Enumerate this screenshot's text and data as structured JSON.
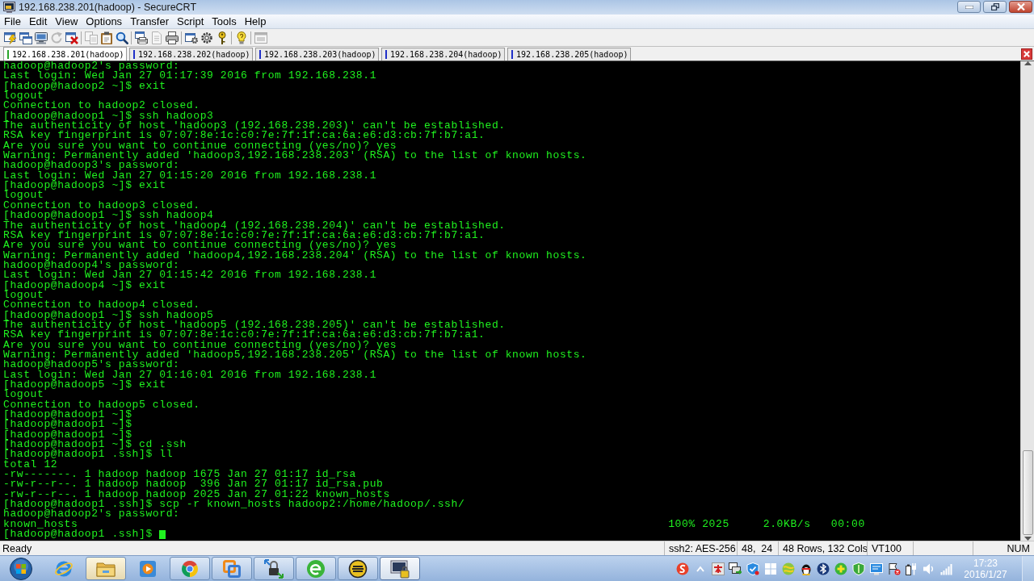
{
  "window": {
    "title": "192.168.238.201(hadoop) - SecureCRT"
  },
  "menu": [
    "File",
    "Edit",
    "View",
    "Options",
    "Transfer",
    "Script",
    "Tools",
    "Help"
  ],
  "toolbar": {
    "groups": [
      [
        {
          "disabled": false
        },
        {
          "disabled": false
        },
        {
          "disabled": false
        },
        {
          "disabled": true
        },
        {
          "disabled": false
        }
      ],
      [
        {
          "disabled": true
        },
        {
          "disabled": false
        },
        {
          "disabled": false
        }
      ],
      [
        {
          "disabled": false
        },
        {
          "disabled": true
        },
        {
          "disabled": false
        }
      ],
      [
        {
          "disabled": false
        },
        {
          "disabled": false
        },
        {
          "disabled": false
        }
      ],
      [
        {
          "disabled": false
        }
      ],
      [
        {
          "disabled": true
        }
      ]
    ]
  },
  "tabs": [
    {
      "label": "192.168.238.201(hadoop)",
      "selected": true,
      "color": "#2aa52a"
    },
    {
      "label": "192.168.238.202(hadoop)",
      "selected": false,
      "color": "#1f2fc8"
    },
    {
      "label": "192.168.238.203(hadoop)",
      "selected": false,
      "color": "#1f2fc8"
    },
    {
      "label": "192.168.238.204(hadoop)",
      "selected": false,
      "color": "#1f2fc8"
    },
    {
      "label": "192.168.238.205(hadoop)",
      "selected": false,
      "color": "#1f2fc8"
    }
  ],
  "terminal": {
    "lines": [
      {
        "kind": "out",
        "text": "hadoop@hadoop2's password:"
      },
      {
        "kind": "out",
        "text": "Last login: Wed Jan 27 01:17:39 2016 from 192.168.238.1"
      },
      {
        "kind": "out",
        "text": "[hadoop@hadoop2 ~]$ exit"
      },
      {
        "kind": "out",
        "text": "logout"
      },
      {
        "kind": "out",
        "text": "Connection to hadoop2 closed."
      },
      {
        "kind": "out",
        "text": "[hadoop@hadoop1 ~]$ ssh hadoop3"
      },
      {
        "kind": "out",
        "text": "The authenticity of host 'hadoop3 (192.168.238.203)' can't be established."
      },
      {
        "kind": "out",
        "text": "RSA key fingerprint is 07:07:8e:1c:c0:7e:7f:1f:ca:6a:e6:d3:cb:7f:b7:a1."
      },
      {
        "kind": "out",
        "text": "Are you sure you want to continue connecting (yes/no)? yes"
      },
      {
        "kind": "out",
        "text": "Warning: Permanently added 'hadoop3,192.168.238.203' (RSA) to the list of known hosts."
      },
      {
        "kind": "out",
        "text": "hadoop@hadoop3's password:"
      },
      {
        "kind": "out",
        "text": "Last login: Wed Jan 27 01:15:20 2016 from 192.168.238.1"
      },
      {
        "kind": "out",
        "text": "[hadoop@hadoop3 ~]$ exit"
      },
      {
        "kind": "out",
        "text": "logout"
      },
      {
        "kind": "out",
        "text": "Connection to hadoop3 closed."
      },
      {
        "kind": "out",
        "text": "[hadoop@hadoop1 ~]$ ssh hadoop4"
      },
      {
        "kind": "out",
        "text": "The authenticity of host 'hadoop4 (192.168.238.204)' can't be established."
      },
      {
        "kind": "out",
        "text": "RSA key fingerprint is 07:07:8e:1c:c0:7e:7f:1f:ca:6a:e6:d3:cb:7f:b7:a1."
      },
      {
        "kind": "out",
        "text": "Are you sure you want to continue connecting (yes/no)? yes"
      },
      {
        "kind": "out",
        "text": "Warning: Permanently added 'hadoop4,192.168.238.204' (RSA) to the list of known hosts."
      },
      {
        "kind": "out",
        "text": "hadoop@hadoop4's password:"
      },
      {
        "kind": "out",
        "text": "Last login: Wed Jan 27 01:15:42 2016 from 192.168.238.1"
      },
      {
        "kind": "out",
        "text": "[hadoop@hadoop4 ~]$ exit"
      },
      {
        "kind": "out",
        "text": "logout"
      },
      {
        "kind": "out",
        "text": "Connection to hadoop4 closed."
      },
      {
        "kind": "out",
        "text": "[hadoop@hadoop1 ~]$ ssh hadoop5"
      },
      {
        "kind": "out",
        "text": "The authenticity of host 'hadoop5 (192.168.238.205)' can't be established."
      },
      {
        "kind": "out",
        "text": "RSA key fingerprint is 07:07:8e:1c:c0:7e:7f:1f:ca:6a:e6:d3:cb:7f:b7:a1."
      },
      {
        "kind": "out",
        "text": "Are you sure you want to continue connecting (yes/no)? yes"
      },
      {
        "kind": "out",
        "text": "Warning: Permanently added 'hadoop5,192.168.238.205' (RSA) to the list of known hosts."
      },
      {
        "kind": "out",
        "text": "hadoop@hadoop5's password:"
      },
      {
        "kind": "out",
        "text": "Last login: Wed Jan 27 01:16:01 2016 from 192.168.238.1"
      },
      {
        "kind": "out",
        "text": "[hadoop@hadoop5 ~]$ exit"
      },
      {
        "kind": "out",
        "text": "logout"
      },
      {
        "kind": "out",
        "text": "Connection to hadoop5 closed."
      },
      {
        "kind": "out",
        "text": "[hadoop@hadoop1 ~]$"
      },
      {
        "kind": "out",
        "text": "[hadoop@hadoop1 ~]$"
      },
      {
        "kind": "out",
        "text": "[hadoop@hadoop1 ~]$"
      },
      {
        "kind": "out",
        "text": "[hadoop@hadoop1 ~]$ cd .ssh"
      },
      {
        "kind": "out",
        "text": "[hadoop@hadoop1 .ssh]$ ll"
      },
      {
        "kind": "out",
        "text": "total 12"
      },
      {
        "kind": "out",
        "text": "-rw-------. 1 hadoop hadoop 1675 Jan 27 01:17 id_rsa"
      },
      {
        "kind": "out",
        "text": "-rw-r--r--. 1 hadoop hadoop  396 Jan 27 01:17 id_rsa.pub"
      },
      {
        "kind": "out",
        "text": "-rw-r--r--. 1 hadoop hadoop 2025 Jan 27 01:22 known_hosts"
      },
      {
        "kind": "out",
        "text": "[hadoop@hadoop1 .ssh]$ scp -r known_hosts hadoop2:/home/hadoop/.ssh/"
      },
      {
        "kind": "out",
        "text": "hadoop@hadoop2's password:"
      },
      {
        "kind": "transfer",
        "file": "known_hosts",
        "percent": "100%",
        "size": "2025",
        "rate": "2.0KB/s",
        "eta": "00:00"
      },
      {
        "kind": "input",
        "text": "[hadoop@hadoop1 .ssh]$"
      }
    ]
  },
  "status_bar": {
    "message": "Ready",
    "encryption": "ssh2: AES-256",
    "cursor": "48,  24",
    "size": "48 Rows, 132 Cols",
    "emulation": "VT100",
    "keyboard": "NUM"
  },
  "taskbar": {
    "apps": [
      {
        "running": false,
        "highlighted": false,
        "selected": false
      },
      {
        "running": true,
        "highlighted": true,
        "selected": false
      },
      {
        "running": false,
        "highlighted": false,
        "selected": false
      },
      {
        "running": true,
        "highlighted": false,
        "selected": false
      },
      {
        "running": true,
        "highlighted": false,
        "selected": false
      },
      {
        "running": true,
        "highlighted": false,
        "selected": false
      },
      {
        "running": true,
        "highlighted": false,
        "selected": false
      },
      {
        "running": true,
        "highlighted": false,
        "selected": false
      },
      {
        "running": true,
        "highlighted": false,
        "selected": true
      }
    ],
    "clock": {
      "time": "17:23",
      "date": "2016/1/27"
    }
  }
}
